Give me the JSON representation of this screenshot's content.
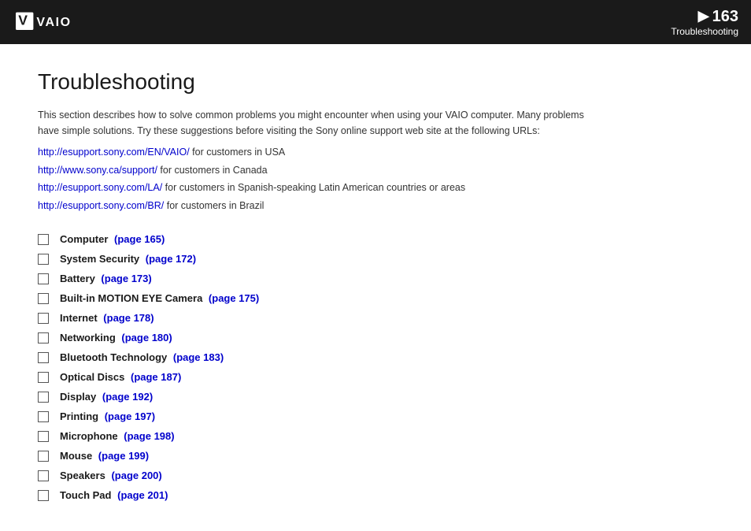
{
  "header": {
    "page_number": "163",
    "arrow": "▶",
    "section": "Troubleshooting"
  },
  "page": {
    "title": "Troubleshooting",
    "intro_line1": "This section describes how to solve common problems you might encounter when using your VAIO computer. Many problems",
    "intro_line2": "have simple solutions. Try these suggestions before visiting the Sony online support web site at the following URLs:",
    "urls": [
      {
        "url": "http://esupport.sony.com/EN/VAIO/",
        "suffix": " for customers in USA"
      },
      {
        "url": "http://www.sony.ca/support/",
        "suffix": " for customers in Canada"
      },
      {
        "url": "http://esupport.sony.com/LA/",
        "suffix": " for customers in Spanish-speaking Latin American countries or areas"
      },
      {
        "url": "http://esupport.sony.com/BR/",
        "suffix": " for customers in Brazil"
      }
    ],
    "toc_items": [
      {
        "label": "Computer",
        "link_text": "(page 165)",
        "page": 165
      },
      {
        "label": "System Security",
        "link_text": "(page 172)",
        "page": 172
      },
      {
        "label": "Battery",
        "link_text": "(page 173)",
        "page": 173
      },
      {
        "label": "Built-in MOTION EYE Camera",
        "link_text": "(page 175)",
        "page": 175
      },
      {
        "label": "Internet",
        "link_text": "(page 178)",
        "page": 178
      },
      {
        "label": "Networking",
        "link_text": "(page 180)",
        "page": 180
      },
      {
        "label": "Bluetooth Technology",
        "link_text": "(page 183)",
        "page": 183
      },
      {
        "label": "Optical Discs",
        "link_text": "(page 187)",
        "page": 187
      },
      {
        "label": "Display",
        "link_text": "(page 192)",
        "page": 192
      },
      {
        "label": "Printing",
        "link_text": "(page 197)",
        "page": 197
      },
      {
        "label": "Microphone",
        "link_text": "(page 198)",
        "page": 198
      },
      {
        "label": "Mouse",
        "link_text": "(page 199)",
        "page": 199
      },
      {
        "label": "Speakers",
        "link_text": "(page 200)",
        "page": 200
      },
      {
        "label": "Touch Pad",
        "link_text": "(page 201)",
        "page": 201
      }
    ]
  }
}
